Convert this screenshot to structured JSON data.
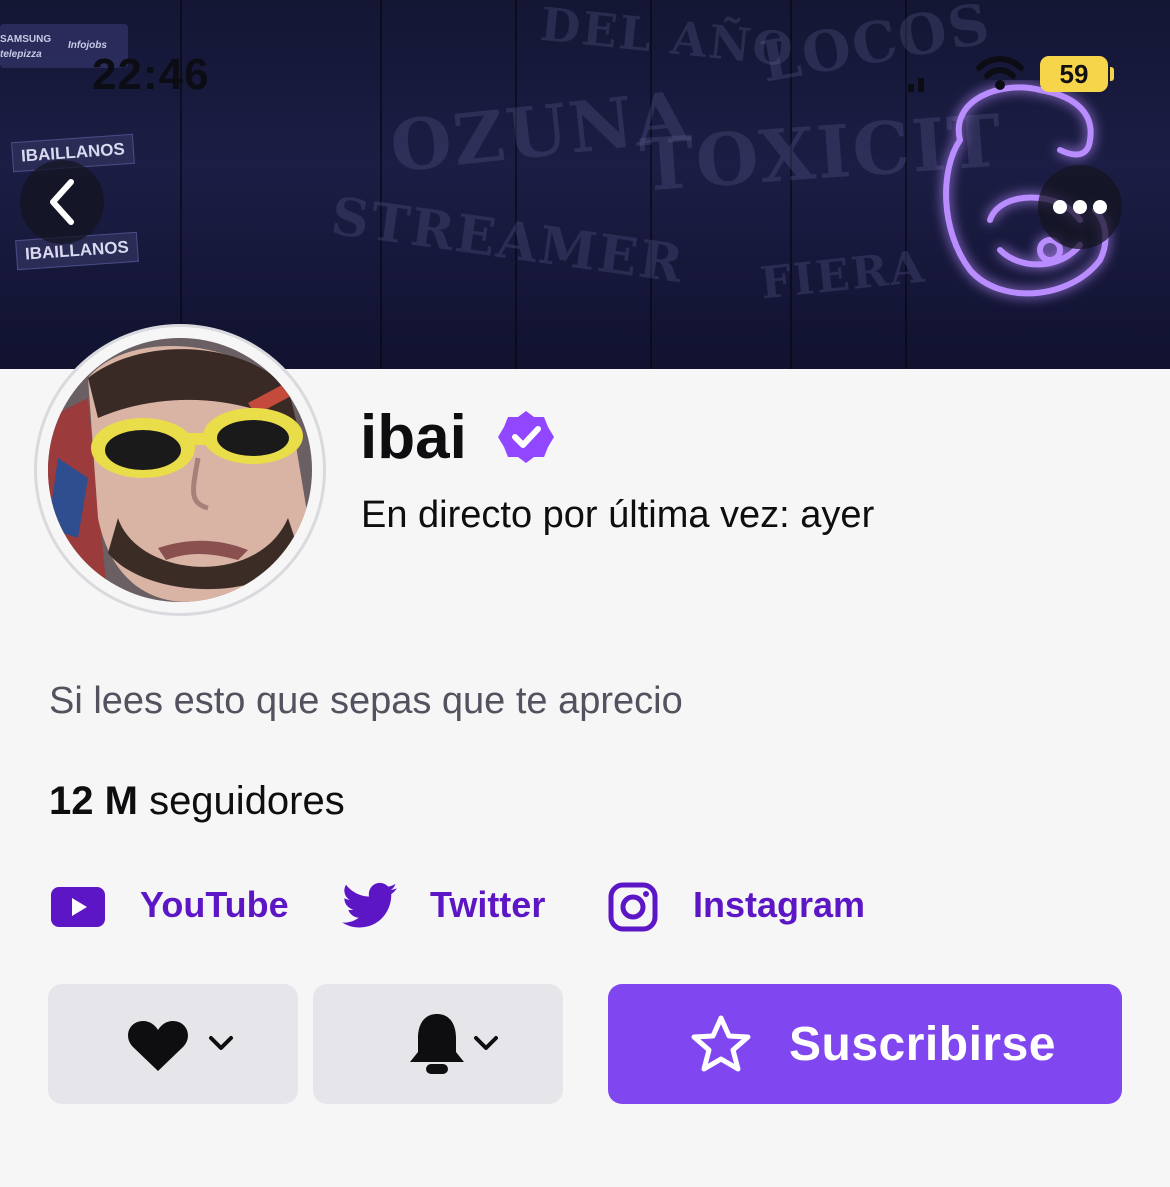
{
  "status_bar": {
    "time": "22:46",
    "battery": "59"
  },
  "banner": {
    "sponsor_1": "SAMSUNG",
    "sponsor_2": "telepizza",
    "sponsor_3": "Infojobs",
    "sign_1": "IBAILLANOS",
    "sign_2": "IBAILLANOS"
  },
  "profile": {
    "name": "ibai",
    "last_live": "En directo por última vez: ayer",
    "bio": "Si lees esto que sepas que te aprecio",
    "followers_count": "12 M",
    "followers_label": "seguidores"
  },
  "social_links": [
    {
      "label": "YouTube",
      "icon": "youtube-icon"
    },
    {
      "label": "Twitter",
      "icon": "twitter-icon"
    },
    {
      "label": "Instagram",
      "icon": "instagram-icon"
    }
  ],
  "actions": {
    "follow_icon": "heart-icon",
    "notify_icon": "bell-icon",
    "subscribe_label": "Suscribirse"
  },
  "colors": {
    "accent": "#8046f0",
    "link": "#5c16c5",
    "verified": "#9147ff"
  }
}
